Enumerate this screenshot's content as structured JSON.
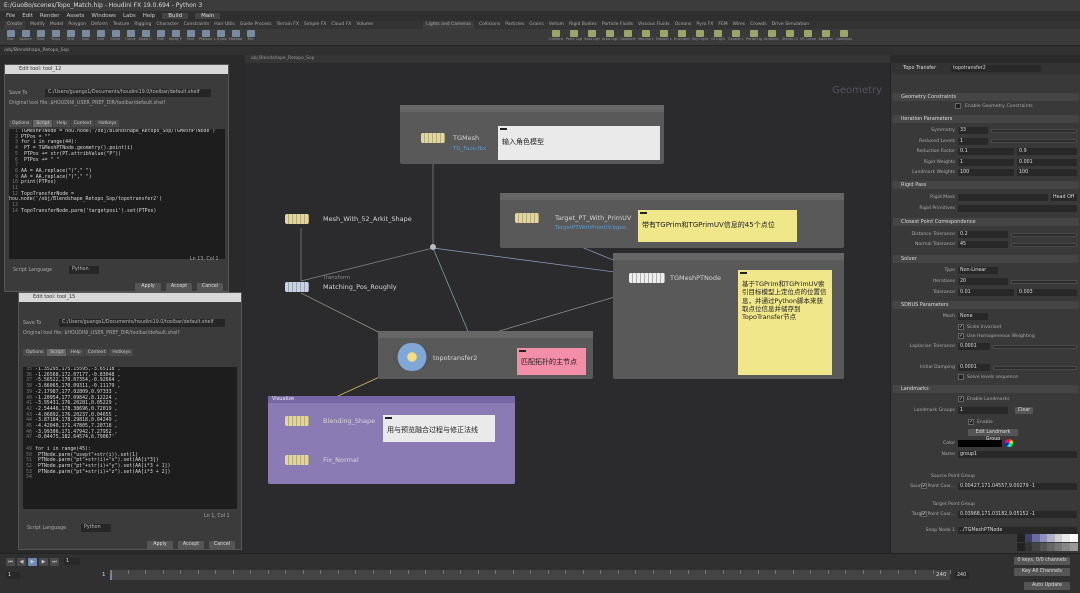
{
  "window": {
    "title": "E:/GuoBo/scenes/Topo_Match.hip - Houdini FX 19.0.694 - Python 3"
  },
  "menu": [
    "File",
    "Edit",
    "Render",
    "Assets",
    "Windows",
    "Labs",
    "Help"
  ],
  "desktop": "Build",
  "layout": "Main",
  "shelf_tabs": [
    "Create",
    "Modify",
    "Model",
    "Polygon",
    "Deform",
    "Texture",
    "Rigging",
    "Character",
    "Constraints",
    "Hair Utils",
    "Guide Process",
    "Terrain FX",
    "Simple FX",
    "Cloud FX",
    "Volume"
  ],
  "shelf_tabs_right": [
    "Lights and Cameras",
    "Collisions",
    "Particles",
    "Grains",
    "Vellum",
    "Rigid Bodies",
    "Particle Fluids",
    "Viscous Fluids",
    "Oceans",
    "Pyro FX",
    "FEM",
    "Wires",
    "Crowds",
    "Drive Simulation"
  ],
  "tools_left": [
    "Box",
    "Sphere",
    "Tube",
    "Torus",
    "Grid",
    "Null",
    "Line",
    "Circle",
    "Curve",
    "Draw Curve",
    "Path",
    "Spray Paint",
    "Font",
    "Platonic Solids",
    "L-System",
    "Metaball",
    "File"
  ],
  "tools_right": [
    "Camera",
    "Point Light",
    "Spot Light",
    "Area Light",
    "Geometry Light",
    "Volume Light",
    "Distant Light",
    "Environment Light",
    "Sky Light",
    "GI Light",
    "Caustic Light",
    "Portal Light",
    "Ambient Light",
    "Stereo Camera",
    "VR Camera",
    "Switcher",
    "Gamepad Camera"
  ],
  "path": "/obj/Blendshape_Retopo_Sop",
  "net_path": "obj  Blendshape_Retopo_Sop",
  "network_context": "Geometry",
  "nodes": {
    "tgmesh": {
      "name": "TGMesh",
      "sub": "TG_Face.fbx"
    },
    "mesh52": {
      "name": "Mesh_With_52_Arkit_Shape"
    },
    "matching": {
      "name": "Matching_Pos_Roughly",
      "type": "Transform"
    },
    "target_pt": {
      "name": "Target_PT_With_PrimUV",
      "sub": "TargetPTWithPrimUV.bgeo"
    },
    "tgmeshpt": {
      "name": "TGMeshPTNode"
    },
    "topotransfer": {
      "name": "topotransfer2"
    },
    "blending": {
      "name": "Blending_Shape"
    },
    "fixnormal": {
      "name": "Fix_Normal"
    }
  },
  "netbox_visualize": "Visualize",
  "stickies": {
    "input_model": "输入角色模型",
    "pt_info": "带有TGPrim和TGPrimUV信息的45个点位",
    "python_info": "基于TGPrim和TGPrimUV索引目标模型上定位点的位置信息，并通过Python脚本来获取点位信息并储存到TopoTransfer节点",
    "topo_main": "匹配拓扑的主节点",
    "preview": "用与预览融合过程与修正法线"
  },
  "editor1": {
    "title": "Edit tool: tool_12",
    "save_to_label": "Save To",
    "save_to": "C:/Users/guangs1/Documents/houdini19.0/toolbar/default.shelf",
    "orig": "Original tool file: $HOUDINI_USER_PREF_DIR/toolbar/default.shelf",
    "tabs": [
      "Options",
      "Script",
      "Help",
      "Context",
      "Hotkeys"
    ],
    "code": [
      "TGMeshPTNode = hou.node('/obj/Blendshape_Retopo_Sop/TGMeshPTNode')",
      "PTPos   = \"\"",
      "for i in range(44):",
      "    PT = TGMeshPTNode.geometry().point(i)",
      "    PTPos += str(PT.attribValue(\"P\"))",
      "    PTPos += \" \"",
      "",
      "AA = AA.replace(\"(\",\" \")",
      "AA = AA.replace(\")\",\" \")",
      "print(PTPos)",
      "",
      "TopoTransferNode = hou.node('/obj/Blendshape_Retopo_Sop/topotransfer2')",
      "",
      "TopoTransferNode.parm('targetposi').set(PTPos)"
    ],
    "status": "Ln 13, Col 1",
    "lang_label": "Script Language",
    "lang": "Python",
    "buttons": [
      "Apply",
      "Accept",
      "Cancel"
    ]
  },
  "editor2": {
    "title": "Edit tool: tool_15",
    "save_to_label": "Save To",
    "save_to": "C:/Users/guangs1/Documents/houdini19.0/toolbar/default.shelf",
    "orig": "Original tool file: $HOUDINI_USER_PREF_DIR/toolbar/default.shelf",
    "tabs": [
      "Options",
      "Script",
      "Help",
      "Context",
      "Hotkeys"
    ],
    "code_nums": [
      "35",
      "36",
      "37",
      "38",
      "39",
      "40",
      "41",
      "42",
      "43",
      "44",
      "45",
      "46",
      "47",
      "",
      "49",
      "50",
      "51",
      "52",
      "53",
      "54"
    ],
    "code": [
      "-1.35295,175.15595,-3.65118 ,",
      "-1.26568,172.07177,-0.83048 ,",
      "-5.56522,170.07354,-0.92664 ,",
      "-3.86065,170.09311,-0.11179 ,",
      "-2.17987,177.02809,0.97333 ,",
      "-1.20954,177.09842,8.12224 ,",
      "-3.95431,176.20281,0.05229 ,",
      "-2.54446,178.38696,0.72019 ,",
      "-4.06892,176.20237,0.04655 ,",
      "-3.87184,178.29818,0.04249 ,",
      "-4.42040,171.47805,7.20718 ,",
      "-3.99306,171.47942,7.27952 ,",
      "-0.84475,182.64574,6.79067'",
      "",
      "for i in range(45):",
      "    PTNode.parm(\"usept\"+str(i)).set(1)",
      "    PTNode.parm(\"pt\"+str(i)+\"x\").set(AA[i*3])",
      "    PTNode.parm(\"pt\"+str(i)+\"y\").set(AA[i*3 + 1])",
      "    PTNode.parm(\"pt\"+str(i)+\"z\").set(AA[i*3 + 2])",
      ""
    ],
    "status": "Ln 1, Col 1",
    "lang_label": "Script Language",
    "lang": "Python",
    "buttons": [
      "Apply",
      "Accept",
      "Cancel"
    ]
  },
  "params": {
    "node_type": "Topo Transfer",
    "node_name": "topotransfer2",
    "sections": {
      "geo": "Geometry Constraints",
      "iter": "Iteration Parameters",
      "rigid": "Rigid Pass",
      "closest": "Closest Point Correspondence",
      "solver": "Solver",
      "sdbus": "SDBUS Parameters",
      "landmarks": "Landmarks"
    },
    "enable_geo": "Enable Geometry Constraints",
    "rows": [
      {
        "label": "Symmetry",
        "v1": "33",
        "v2": ""
      },
      {
        "label": "Reduced Levels",
        "v1": "1",
        "v2": ""
      },
      {
        "label": "Reduction Factor",
        "v1": "0.1",
        "v2": "0.9"
      },
      {
        "label": "Rigid Weights",
        "v1": "1",
        "v2": "0.001"
      },
      {
        "label": "Landmark Weights",
        "v1": "100",
        "v2": "100"
      }
    ],
    "rigid_rows": [
      {
        "label": "Rigid Mask",
        "v1": ""
      },
      {
        "label": "Rigid Primitives",
        "v1": ""
      }
    ],
    "rigid_menu": "Head Off",
    "closest_rows": [
      {
        "label": "Distance Tolerance",
        "v1": "0.2"
      },
      {
        "label": "Normal Tolerance",
        "v1": "45"
      }
    ],
    "solver_rows": [
      {
        "label": "Type",
        "v1": "Non-Linear"
      },
      {
        "label": "Iterations",
        "v1": "20"
      },
      {
        "label": "Tolerance",
        "v1": "0.01",
        "v2": "0.003"
      }
    ],
    "mesh_label": "Mesh",
    "mesh_val": "None",
    "sdbus_checks": [
      "Scale Invariant",
      "Use Homogeneous Weighting"
    ],
    "sdbus_rows": [
      {
        "label": "Laplacian Tolerance",
        "v1": "0.0001"
      },
      {
        "label": "Initial Damping",
        "v1": "0.0001"
      }
    ],
    "sdbus_seq": "Solve levels sequence",
    "landmark_enable": "Enable Landmarks",
    "landmark_groups_label": "Landmark Groups",
    "landmark_groups": "1",
    "clear": "Clear",
    "enable": "Enable",
    "edit_group": "Edit Landmark Group",
    "color_label": "Color",
    "name_label": "Name",
    "name_val": "group1",
    "source_group": "Source Point Group",
    "source_label": "Source Point Coor...",
    "source_val": "0.00427,171.04557,9.00279 -1",
    "target_group": "Target Point Group",
    "target_label": "Target Point Coor...",
    "target_val": "0.03968,171.03182,9.05152 -1",
    "snap_label": "Snap Node 1",
    "snap_val": "../TGMeshPTNode"
  },
  "timeline": {
    "start": "1",
    "current": "1",
    "end1": "240",
    "end2": "240",
    "frame": "1",
    "markers": [
      "72",
      "48",
      "96",
      "120",
      "144",
      "168",
      "192",
      "216"
    ],
    "keys_label": "0 keys, 0/0 channels",
    "key_all": "Key All Channels",
    "auto_update": "Auto Update"
  },
  "colors": {
    "accent_blue": "#5b9bd5",
    "visualize_box": "#8a7bb5",
    "sticky_yellow": "#f0e68a",
    "sticky_pink": "#f28ea8",
    "sticky_white": "#eaeaea"
  }
}
